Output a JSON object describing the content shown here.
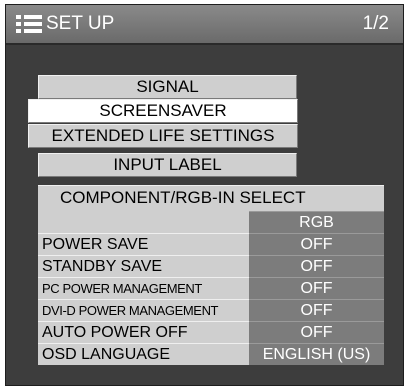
{
  "header": {
    "title": "SET UP",
    "page": "1/2",
    "icon": "menu-list-icon"
  },
  "menu_buttons": [
    {
      "label": "SIGNAL",
      "selected": false
    },
    {
      "label": "SCREENSAVER",
      "selected": true
    },
    {
      "label": "EXTENDED LIFE SETTINGS",
      "selected": false
    },
    {
      "label": "INPUT LABEL",
      "selected": false
    }
  ],
  "component_rgb": {
    "label": "COMPONENT/RGB-IN SELECT",
    "value": "RGB"
  },
  "settings": [
    {
      "label": "POWER SAVE",
      "value": "OFF"
    },
    {
      "label": "STANDBY SAVE",
      "value": "OFF"
    },
    {
      "label": "PC POWER MANAGEMENT",
      "value": "OFF"
    },
    {
      "label": "DVI-D POWER MANAGEMENT",
      "value": "OFF"
    },
    {
      "label": "AUTO POWER OFF",
      "value": "OFF"
    },
    {
      "label": "OSD LANGUAGE",
      "value": "ENGLISH (US)"
    }
  ],
  "colors": {
    "panel_bg": "#3d3d3d",
    "button_bg": "#cfcfcf",
    "selected_bg": "#ffffff",
    "value_bg": "#7c7c7c",
    "header_bg": "#7a7a7a"
  }
}
